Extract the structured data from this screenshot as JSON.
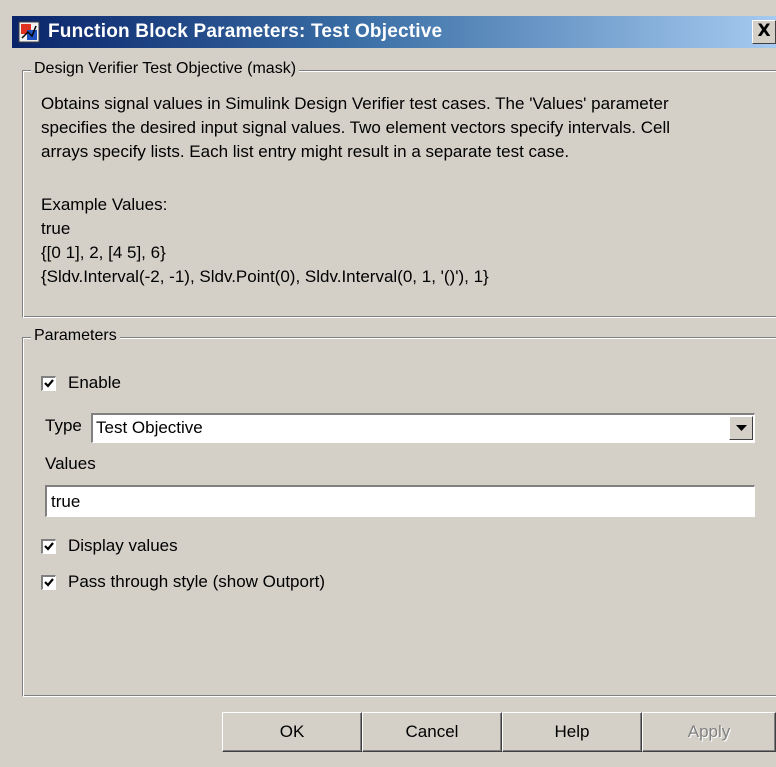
{
  "window": {
    "title": "Function Block Parameters: Test Objective",
    "close_label": "X"
  },
  "description": {
    "legend": "Design Verifier Test Objective (mask)",
    "lines": [
      "Obtains signal values in Simulink Design Verifier test cases.  The 'Values' parameter",
      "specifies the desired input signal values.  Two element vectors specify intervals.  Cell",
      "arrays specify lists.  Each list entry might result in a separate test case."
    ],
    "example_heading": "Example Values:",
    "examples": [
      "true",
      "{[0 1], 2, [4 5], 6}",
      "{Sldv.Interval(-2, -1), Sldv.Point(0), Sldv.Interval(0, 1, '()'), 1}"
    ]
  },
  "parameters": {
    "legend": "Parameters",
    "enable": {
      "label": "Enable",
      "checked": true
    },
    "type": {
      "label": "Type",
      "value": "Test Objective"
    },
    "values": {
      "label": "Values",
      "value": "true"
    },
    "display_values": {
      "label": "Display values",
      "checked": true
    },
    "pass_through": {
      "label": "Pass through style (show Outport)",
      "checked": true
    }
  },
  "buttons": {
    "ok": "OK",
    "cancel": "Cancel",
    "help": "Help",
    "apply": "Apply"
  },
  "colors": {
    "titlebar_start": "#0a246a",
    "titlebar_end": "#a6caf0",
    "dialog_bg": "#d4d0c8",
    "disabled_text": "#808080"
  }
}
